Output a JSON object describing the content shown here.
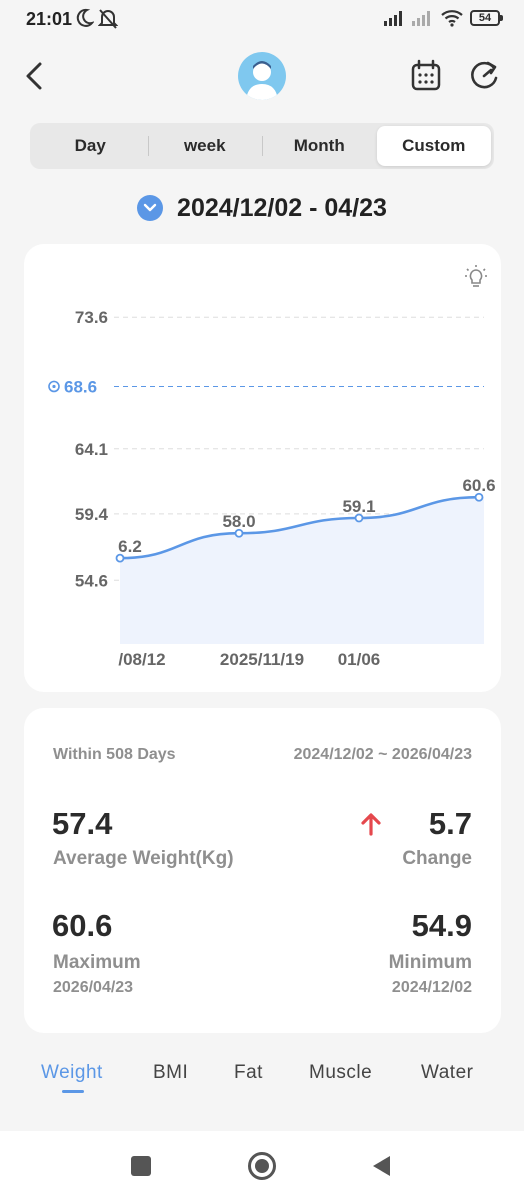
{
  "status_bar": {
    "time": "21:01",
    "battery": "54"
  },
  "header": {
    "avatar_icon": "user-avatar",
    "calendar_icon": "calendar-icon",
    "refresh_icon": "refresh-icon",
    "back_icon": "back-arrow-icon"
  },
  "tabs": [
    {
      "label": "Day",
      "active": false
    },
    {
      "label": "week",
      "active": false
    },
    {
      "label": "Month",
      "active": false
    },
    {
      "label": "Custom",
      "active": true
    }
  ],
  "date_range": {
    "label": "2024/12/02 - 04/23"
  },
  "chart_data": {
    "type": "area",
    "y_ticks": [
      "73.6",
      "64.1",
      "59.4",
      "54.6"
    ],
    "ylim": [
      50.0,
      76.0
    ],
    "target": {
      "value": 68.6,
      "label": "68.6"
    },
    "x_tick_labels": [
      "/08/12",
      "2025/11/19",
      "01/06"
    ],
    "points": [
      {
        "x": 0,
        "y": 56.2,
        "label": "6.2"
      },
      {
        "x": 1,
        "y": 58.0,
        "label": "58.0"
      },
      {
        "x": 2,
        "y": 59.1,
        "label": "59.1"
      },
      {
        "x": 3,
        "y": 60.6,
        "label": "60.6"
      }
    ],
    "line_color": "#5b97e6",
    "fill_color": "#eef3fd"
  },
  "stats": {
    "within_label": "Within 508 Days",
    "range_label": "2024/12/02 ~ 2026/04/23",
    "average": {
      "value": "57.4",
      "label": "Average Weight(Kg)"
    },
    "change": {
      "value": "5.7",
      "label": "Change",
      "direction": "up"
    },
    "maximum": {
      "value": "60.6",
      "label": "Maximum",
      "date": "2026/04/23"
    },
    "minimum": {
      "value": "54.9",
      "label": "Minimum",
      "date": "2024/12/02"
    }
  },
  "metric_tabs": [
    {
      "label": "Weight",
      "active": true
    },
    {
      "label": "BMI",
      "active": false
    },
    {
      "label": "Fat",
      "active": false
    },
    {
      "label": "Muscle",
      "active": false
    },
    {
      "label": "Water",
      "active": false
    }
  ]
}
